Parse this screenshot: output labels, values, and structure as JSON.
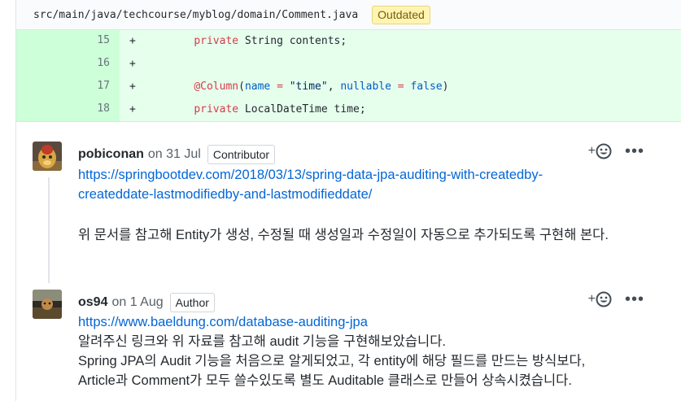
{
  "file": {
    "path": "src/main/java/techcourse/myblog/domain/Comment.java",
    "badge": "Outdated"
  },
  "diff": {
    "lines": [
      {
        "num": "15",
        "sign": "+",
        "indent": "    "
      },
      {
        "num": "16",
        "sign": "+",
        "indent": ""
      },
      {
        "num": "17",
        "sign": "+",
        "indent": "    "
      },
      {
        "num": "18",
        "sign": "+",
        "indent": "    "
      }
    ],
    "line15": {
      "kw": "private",
      "type": " String",
      "rest": " contents;"
    },
    "line17": {
      "ann": "@Column",
      "open": "(",
      "name_key": "name",
      "eq1": " = ",
      "name_val": "\"time\"",
      "comma": ", ",
      "null_key": "nullable",
      "eq2": " = ",
      "null_val": "false",
      "close": ")"
    },
    "line18": {
      "kw": "private",
      "rest": " LocalDateTime time;"
    }
  },
  "comments": [
    {
      "author": "pobiconan",
      "date": "on 31 Jul",
      "role": "Contributor",
      "link": "https://springbootdev.com/2018/03/13/spring-data-jpa-auditing-with-createdby-createddate-lastmodifiedby-and-lastmodifieddate/",
      "link_line1": "https://springbootdev.com/2018/03/13/spring-data-jpa-auditing-with-createdby-",
      "link_line2": "createddate-lastmodifiedby-and-lastmodifieddate/",
      "text": "위 문서를 참고해 Entity가 생성, 수정될 때 생성일과 수정일이 자동으로 추가되도록 구현해 본다."
    },
    {
      "author": "os94",
      "date": "on 1 Aug",
      "role": "Author",
      "link": "https://www.baeldung.com/database-auditing-jpa",
      "line1": "알려주신 링크와 위 자료를 참고해 audit 기능을 구현해보았습니다.",
      "line2": "Spring JPA의 Audit 기능을 처음으로 알게되었고, 각 entity에 해당 필드를 만드는 방식보다,",
      "line3": "Article과 Comment가 모두 쓸수있도록 별도 Auditable 클래스로 만들어 상속시켰습니다."
    }
  ],
  "actions": {
    "react_plus": "+",
    "more": "•••"
  },
  "icons": [
    "smiley-icon",
    "kebab-icon"
  ]
}
